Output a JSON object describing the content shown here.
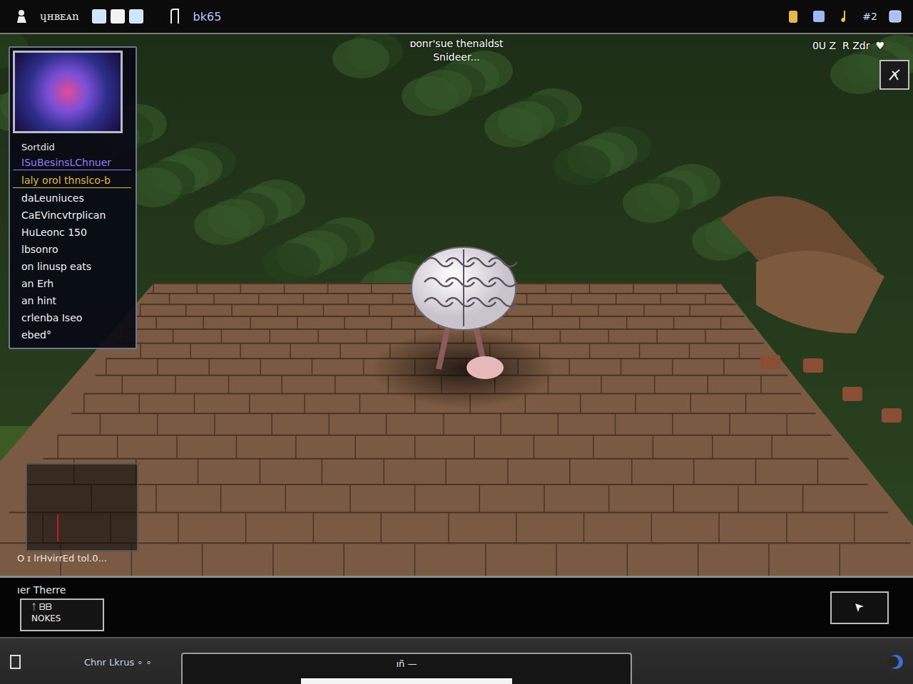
{
  "top_bar": {
    "title": "ɥʜʙᴇᴀn",
    "counter": "bk65",
    "right_label": "#2"
  },
  "scene": {
    "caption": "ɒonr'sue thenaldst",
    "subcaption": "Snideer...",
    "stats": "0U Z  R Zdr",
    "heart": "♥",
    "footer": "O ɪ lrHvirrEd tol.0..."
  },
  "side_panel": {
    "header": "Sortdid",
    "items": [
      {
        "label": "ISuBesinsLChnuer",
        "underlined": true,
        "color": "#8f7ff5"
      },
      {
        "label": "laly orol thnslco-b",
        "underlined": true,
        "color": "#e2b93a"
      },
      {
        "label": "daLeuniuces",
        "underlined": false,
        "color": "#f2f2f2"
      },
      {
        "label": "CaEVincvtrplican",
        "underlined": false,
        "color": "#f2f2f2"
      },
      {
        "label": "HuLeonc 150",
        "underlined": false,
        "color": "#f2f2f2"
      },
      {
        "label": "lbsonro",
        "underlined": false,
        "color": "#f2f2f2"
      },
      {
        "label": "on linusp eats",
        "underlined": false,
        "color": "#f2f2f2"
      },
      {
        "label": "an Erh",
        "underlined": false,
        "color": "#f2f2f2"
      },
      {
        "label": "an hint",
        "underlined": false,
        "color": "#f2f2f2"
      },
      {
        "label": "crlenba Iseo",
        "underlined": false,
        "color": "#f2f2f2"
      },
      {
        "label": "ebed°",
        "underlined": false,
        "color": "#f2f2f2"
      }
    ]
  },
  "lower_panel": {
    "label": "ıer Therre",
    "box_top": "ᛏ ᗷᗷ",
    "box_bottom": "NOKES"
  },
  "bottom_bar": {
    "label": "Chnr Lkrus ∘ ∘",
    "input_text": "ıñ —",
    "level": 0.47
  }
}
